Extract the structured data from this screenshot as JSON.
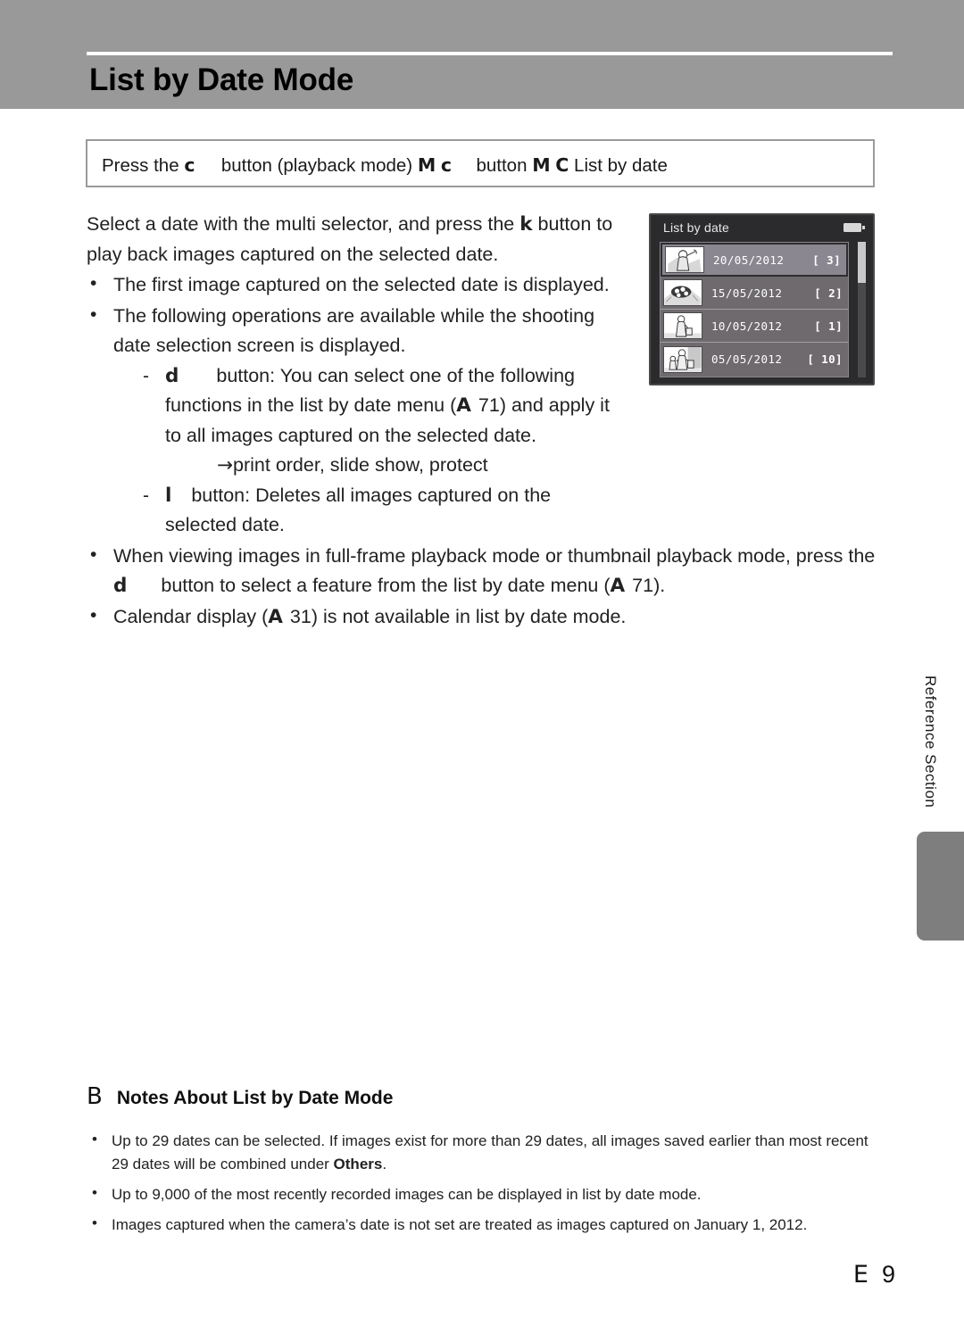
{
  "header": {
    "title": "List by Date Mode",
    "band_color": "#999999",
    "rule_color": "#ffffff"
  },
  "path_box": {
    "prefix": "Press the",
    "glyph_playback": "c",
    "mid1": "button (playback mode)",
    "glyph_arrow1": "M",
    "glyph_playback2": "c",
    "mid2": "button",
    "glyph_arrow2": "M",
    "glyph_calendar": "C",
    "suffix": "List by date",
    "full_text": "Press the c button (playback mode) M c button M C List by date"
  },
  "body": {
    "intro": "Select a date with the multi selector, and press the",
    "intro_glyph": "k",
    "intro_rest": "button to play back images captured on the selected date.",
    "bullets": [
      {
        "text": "The first image captured on the selected date is displayed."
      },
      {
        "text": "The following operations are available while the shooting date selection screen is displayed.",
        "subitems": [
          {
            "glyph": "d",
            "text_before_ref": "button: You can select one of the following functions in the list by date menu (",
            "ref_glyph": "A",
            "ref_page": "71",
            "text_after_ref": ") and apply it to all images captured on the selected date.",
            "arrow_glyph": "→",
            "arrow_text": "print order, slide show, protect"
          },
          {
            "glyph": "l",
            "text_before_ref": "button: Deletes all images captured on the selected date.",
            "ref_glyph": "",
            "ref_page": "",
            "text_after_ref": ""
          }
        ]
      },
      {
        "text_part1": "When viewing images in full-frame playback mode or thumbnail playback mode, press the",
        "glyph": "d",
        "text_part2": "button to select a feature from the list by date menu (",
        "ref_glyph": "A",
        "ref_page": "71",
        "text_part3": ")."
      },
      {
        "text_part1": "Calendar display (",
        "ref_glyph": "A",
        "ref_page": "31",
        "text_part3": ") is not available in list by date mode."
      }
    ]
  },
  "lcd": {
    "title": "List by date",
    "battery_icon": "battery-icon",
    "rows": [
      {
        "date": "20/05/2012",
        "count": "[    3]",
        "selected": true,
        "thumb": "woman-with-parasol"
      },
      {
        "date": "15/05/2012",
        "count": "[    2]",
        "selected": false,
        "thumb": "flowers"
      },
      {
        "date": "10/05/2012",
        "count": "[    1]",
        "selected": false,
        "thumb": "woman-with-bag"
      },
      {
        "date": "05/05/2012",
        "count": "[  10]",
        "selected": false,
        "thumb": "mother-and-child"
      }
    ],
    "screen_bg": "#2b2b2d",
    "list_bg": "#6e6a6e",
    "selected_bg": "#8b8790"
  },
  "side": {
    "label": "Reference Section",
    "tab_color": "#7e7e7e"
  },
  "notes": {
    "heading_glyph": "B",
    "heading": "Notes About List by Date Mode",
    "items": [
      {
        "text_before_bold": "Up to 29 dates can be selected. If images exist for more than 29 dates, all images saved earlier than most recent 29 dates will be combined under ",
        "bold": "Others",
        "text_after_bold": "."
      },
      {
        "text_before_bold": "Up to 9,000 of the most recently recorded images can be displayed in list by date mode.",
        "bold": "",
        "text_after_bold": ""
      },
      {
        "text_before_bold": "Images captured when the camera’s date is not set are treated as images captured on January 1, 2012.",
        "bold": "",
        "text_after_bold": ""
      }
    ]
  },
  "footer": {
    "section_glyph": "E",
    "page_number": "9"
  }
}
